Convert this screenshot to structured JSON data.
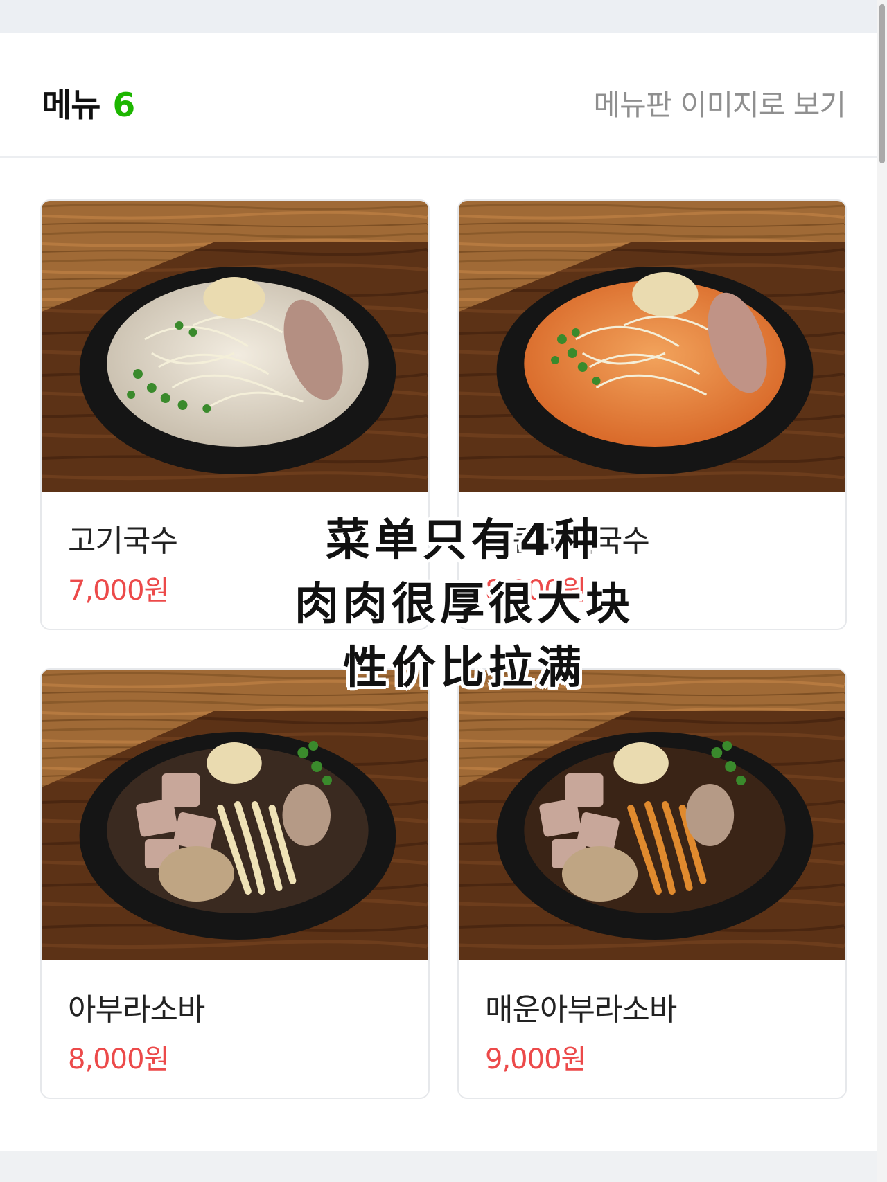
{
  "header": {
    "title": "메뉴",
    "count": "6",
    "menu_board_link": "메뉴판 이미지로 보기"
  },
  "menu_items": [
    {
      "name": "고기국수",
      "price": "7,000원",
      "photo": "rice-noodle-white-broth-bowl"
    },
    {
      "name": "얼큰고기국수",
      "price": "8,000원",
      "photo": "rice-noodle-spicy-broth-bowl"
    },
    {
      "name": "아부라소바",
      "price": "8,000원",
      "photo": "abura-soba-bowl"
    },
    {
      "name": "매운아부라소바",
      "price": "9,000원",
      "photo": "spicy-abura-soba-bowl"
    }
  ],
  "overlay": {
    "lines": [
      "菜单只有4种",
      "肉肉很厚很大块",
      "性价比拉满"
    ]
  },
  "colors": {
    "count_green": "#1db600",
    "price_red": "#ec4a4a",
    "link_gray": "#8f8f8f"
  }
}
